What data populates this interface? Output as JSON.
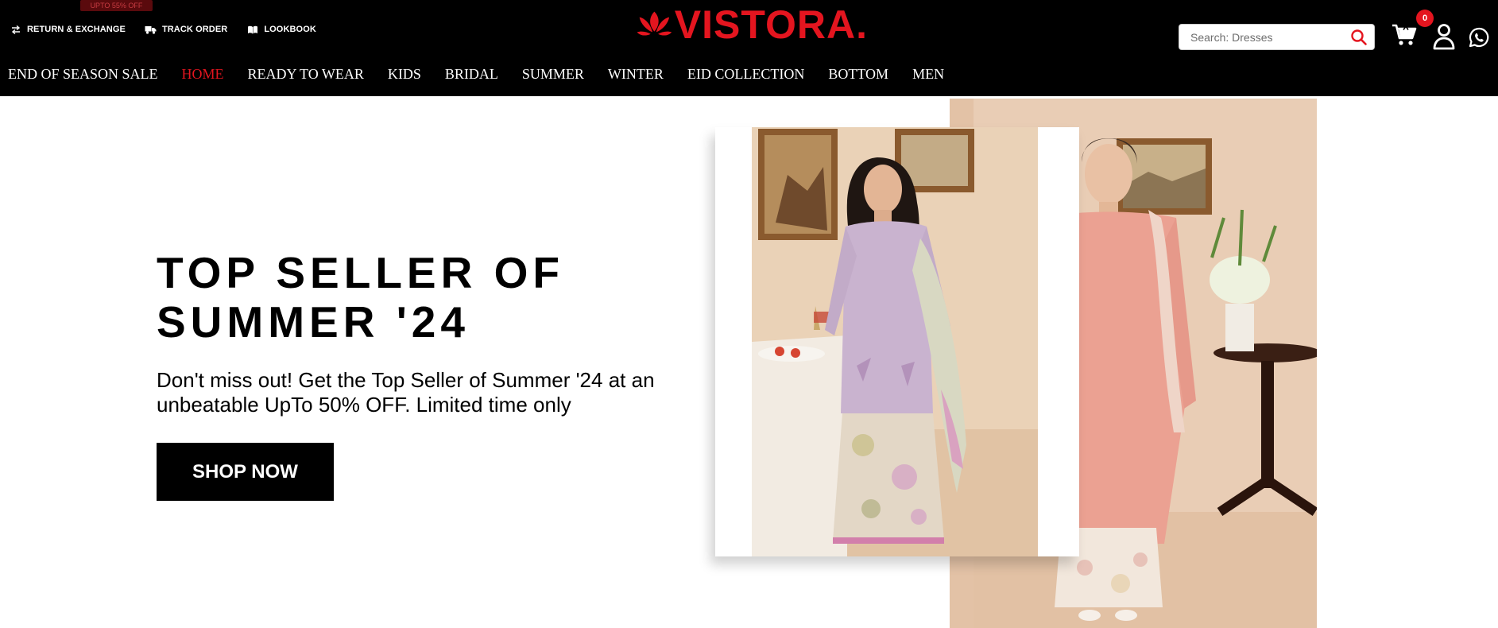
{
  "utility_links": [
    {
      "label": "RETURN & EXCHANGE",
      "icon": "exchange-icon"
    },
    {
      "label": "TRACK ORDER",
      "icon": "truck-icon"
    },
    {
      "label": "LOOKBOOK",
      "icon": "book-icon"
    }
  ],
  "logo": {
    "text": "VISTORA.",
    "color": "#e4151f"
  },
  "search": {
    "placeholder": "Search: Dresses",
    "icon": "search-icon"
  },
  "cart": {
    "count": "0",
    "icon": "cart-icon"
  },
  "account": {
    "icon": "user-icon"
  },
  "whatsapp": {
    "icon": "whatsapp-icon"
  },
  "nav": {
    "sale_badge": "UPTO 55% OFF",
    "items": [
      {
        "label": "END OF SEASON SALE"
      },
      {
        "label": "HOME",
        "active": true
      },
      {
        "label": "READY TO WEAR"
      },
      {
        "label": "KIDS"
      },
      {
        "label": "BRIDAL"
      },
      {
        "label": "SUMMER"
      },
      {
        "label": "WINTER"
      },
      {
        "label": "EID COLLECTION"
      },
      {
        "label": "BOTTOM"
      },
      {
        "label": "MEN"
      }
    ]
  },
  "hero": {
    "title_line1": "TOP SELLER OF",
    "title_line2": "SUMMER '24",
    "text": "Don't miss out! Get the Top Seller of Summer '24 at an unbeatable UpTo 50% OFF. Limited time only",
    "button": "SHOP NOW"
  },
  "colors": {
    "accent": "#e4151f",
    "header_bg": "#000000",
    "hero_bg": "#ffffff"
  }
}
